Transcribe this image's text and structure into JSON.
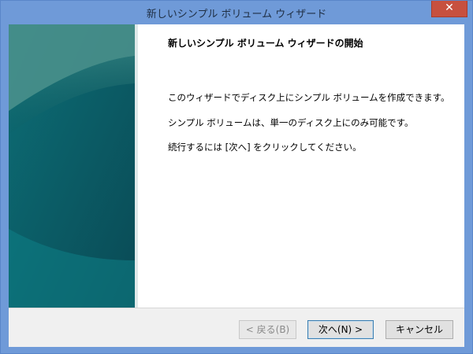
{
  "window": {
    "title": "新しいシンプル ボリューム ウィザード",
    "close_label": "✕"
  },
  "content": {
    "heading": "新しいシンプル ボリューム ウィザードの開始",
    "paragraphs": [
      "このウィザードでディスク上にシンプル ボリュームを作成できます。",
      "シンプル ボリュームは、単一のディスク上にのみ可能です。",
      "続行するには [次へ] をクリックしてください。"
    ]
  },
  "buttons": {
    "back": "< 戻る(B)",
    "next": "次へ(N) >",
    "cancel": "キャンセル"
  },
  "colors": {
    "title_bar": "#6f9ad8",
    "close_button": "#c7503f",
    "banner": "#0b4b50"
  }
}
